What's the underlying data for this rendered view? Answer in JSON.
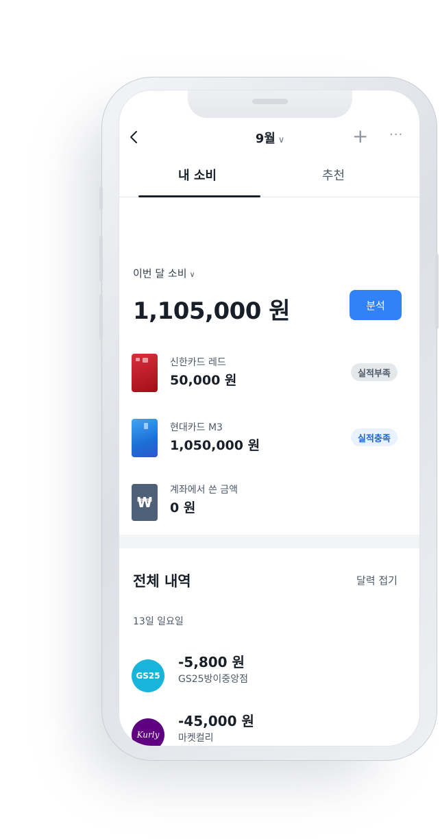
{
  "header": {
    "month": "9월",
    "tabs": [
      "내 소비",
      "추천"
    ]
  },
  "summary": {
    "label": "이번 달 소비",
    "total": "1,105,000 원",
    "analyze_button": "분석"
  },
  "cards": [
    {
      "name": "신한카드 레드",
      "amount": "50,000 원",
      "badge": "실적부족",
      "color": "#c8202c"
    },
    {
      "name": "현대카드 M3",
      "amount": "1,050,000 원",
      "badge": "실적충족",
      "color": "#2b84e8"
    },
    {
      "name": "계좌에서 쓴 금액",
      "amount": "0 원",
      "color": "#4e5f78"
    }
  ],
  "history": {
    "title": "전체 내역",
    "calendar_toggle": "달력 접기",
    "date": "13일 일요일",
    "transactions": [
      {
        "amount": "-5,800 원",
        "merchant": "GS25방이중앙점",
        "logo": "GS25",
        "color": "#18b4d9"
      },
      {
        "amount": "-45,000 원",
        "merchant": "마켓컬리",
        "logo": "Kurly",
        "color": "#5f0080"
      }
    ]
  },
  "colors": {
    "accent": "#3182f6",
    "text": "#191f28",
    "subtext": "#4e5968"
  }
}
